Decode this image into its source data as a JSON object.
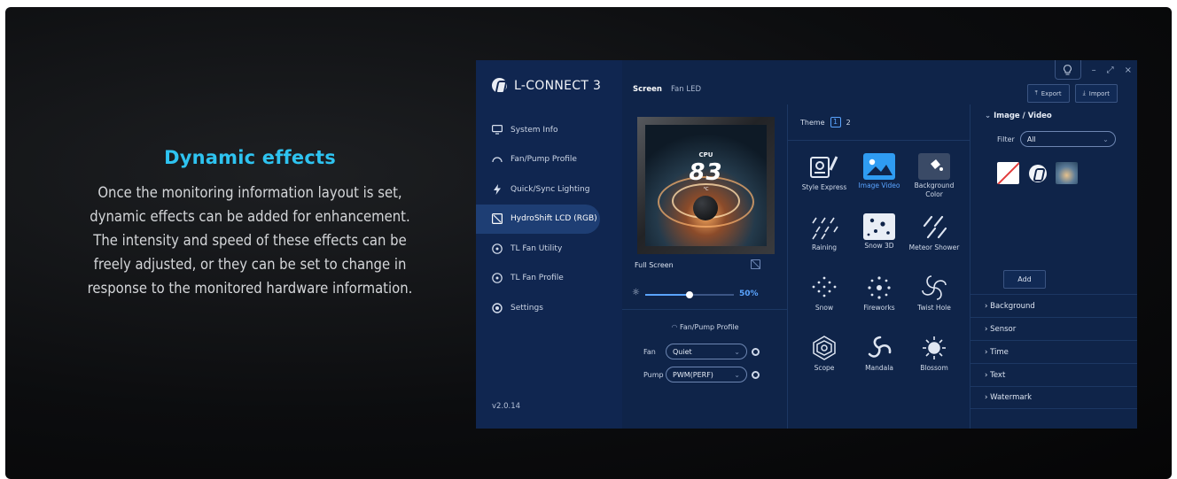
{
  "promo": {
    "title": "Dynamic effects",
    "lines": [
      "Once the monitoring information layout is set,",
      "dynamic effects can be added for enhancement.",
      "The intensity and speed of these effects can be",
      "freely adjusted, or they can be set to change in",
      "response to the monitored hardware information."
    ]
  },
  "app": {
    "name": "L-CONNECT 3",
    "version": "v2.0.14",
    "nav": [
      {
        "label": "System Info",
        "icon": "monitor-icon"
      },
      {
        "label": "Fan/Pump Profile",
        "icon": "gauge-icon"
      },
      {
        "label": "Quick/Sync Lighting",
        "icon": "lightning-icon"
      },
      {
        "label": "HydroShift LCD (RGB)",
        "icon": "lcd-icon",
        "active": true
      },
      {
        "label": "TL Fan Utility",
        "icon": "fan-icon"
      },
      {
        "label": "TL Fan Profile",
        "icon": "fan-profile-icon"
      },
      {
        "label": "Settings",
        "icon": "settings-icon"
      }
    ],
    "tabs": [
      {
        "label": "Screen",
        "active": true
      },
      {
        "label": "Fan LED",
        "active": false
      }
    ],
    "window": {
      "minimize": "–",
      "maximize": "⤢",
      "close": "×"
    },
    "export_label": "Export",
    "import_label": "Import",
    "preview": {
      "cpu_label": "CPU",
      "cpu_value": "83",
      "cpu_unit": "°C",
      "fullscreen_label": "Full Screen",
      "brightness": "50%",
      "brightness_fraction": 0.5,
      "fan_pump_title": "Fan/Pump Profile",
      "fan_label": "Fan",
      "fan_value": "Quiet",
      "pump_label": "Pump",
      "pump_value": "PWM(PERF)"
    },
    "theme": {
      "label": "Theme",
      "page_current": "1",
      "page_other": "2",
      "items": [
        {
          "label": "Style Express",
          "icon": "style-express-icon"
        },
        {
          "label": "Image Video",
          "icon": "image-video-icon",
          "active": true
        },
        {
          "label": "Background Color",
          "icon": "background-color-icon"
        },
        {
          "label": "Raining",
          "icon": "raining-icon"
        },
        {
          "label": "Snow 3D",
          "icon": "snow-3d-icon"
        },
        {
          "label": "Meteor Shower",
          "icon": "meteor-shower-icon"
        },
        {
          "label": "Snow",
          "icon": "snow-icon"
        },
        {
          "label": "Fireworks",
          "icon": "fireworks-icon"
        },
        {
          "label": "Twist Hole",
          "icon": "twist-hole-icon"
        },
        {
          "label": "Scope",
          "icon": "scope-icon"
        },
        {
          "label": "Mandala",
          "icon": "mandala-icon"
        },
        {
          "label": "Blossom",
          "icon": "blossom-icon"
        }
      ]
    },
    "right_panel": {
      "section_title": "Image / Video",
      "filter_label": "Filter",
      "filter_value": "All",
      "add_label": "Add",
      "sections": [
        "Background",
        "Sensor",
        "Time",
        "Text",
        "Watermark"
      ]
    }
  }
}
